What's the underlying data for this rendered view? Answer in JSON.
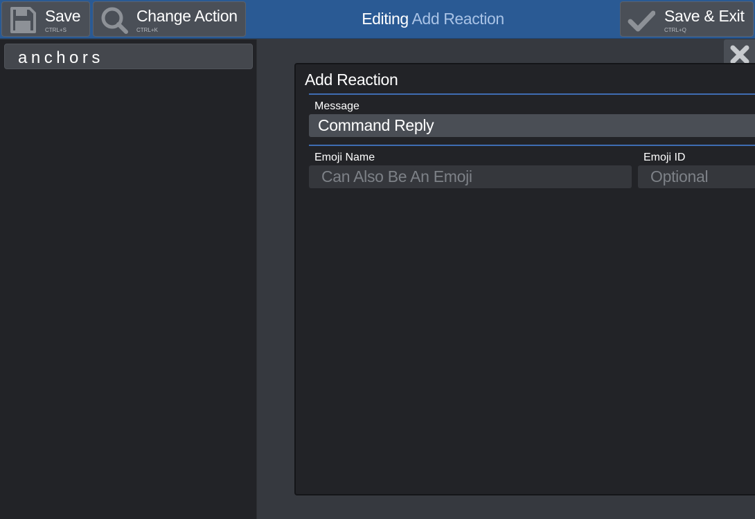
{
  "toolbar": {
    "save": {
      "label": "Save",
      "shortcut": "CTRL+S",
      "icon": "floppy-disk-icon"
    },
    "change_action": {
      "label": "Change Action",
      "shortcut": "CTRL+K",
      "icon": "magnifier-icon"
    },
    "save_exit": {
      "label": "Save & Exit",
      "shortcut": "CTRL+Q",
      "icon": "checkmark-icon"
    },
    "title_prefix": "Editing",
    "title_name": "Add Reaction"
  },
  "sidebar": {
    "items": [
      {
        "label": "anchors"
      }
    ]
  },
  "close_button": {
    "icon": "close-x-icon"
  },
  "panel": {
    "title": "Add Reaction",
    "message": {
      "label": "Message",
      "value": "Command Reply"
    },
    "emoji_name": {
      "label": "Emoji Name",
      "value": "",
      "placeholder": "Can Also Be An Emoji"
    },
    "emoji_id": {
      "label": "Emoji ID",
      "value": "",
      "placeholder": "Optional"
    }
  },
  "colors": {
    "topbar": "#2a5a94",
    "accent": "#3f6db3",
    "title_highlight": "#a9c3e6",
    "background": "#36393f",
    "panel": "#222327"
  }
}
